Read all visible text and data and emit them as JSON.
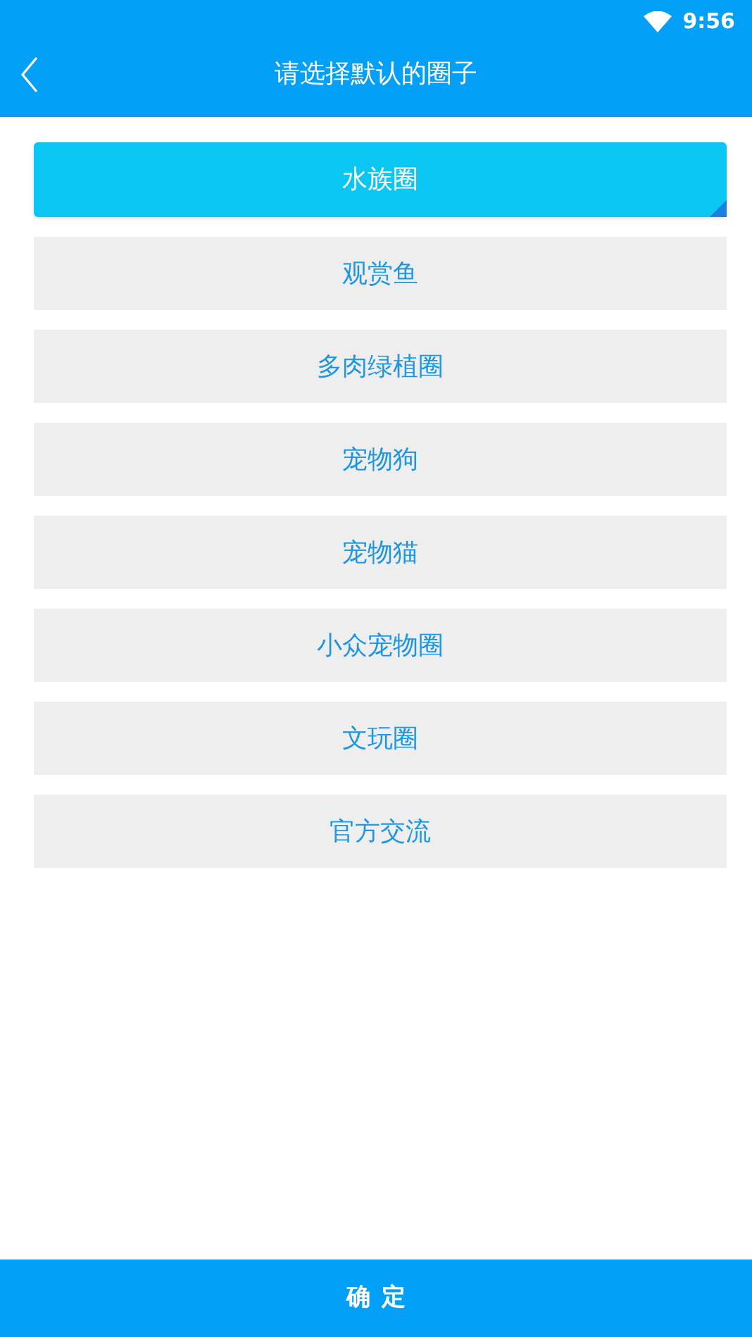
{
  "status_bar": {
    "time": "9:56"
  },
  "header": {
    "title": "请选择默认的圈子"
  },
  "circles": [
    {
      "label": "水族圈",
      "selected": true
    },
    {
      "label": "观赏鱼",
      "selected": false
    },
    {
      "label": "多肉绿植圈",
      "selected": false
    },
    {
      "label": "宠物狗",
      "selected": false
    },
    {
      "label": "宠物猫",
      "selected": false
    },
    {
      "label": "小众宠物圈",
      "selected": false
    },
    {
      "label": "文玩圈",
      "selected": false
    },
    {
      "label": "官方交流",
      "selected": false
    }
  ],
  "confirm_button": {
    "label": "确定"
  }
}
